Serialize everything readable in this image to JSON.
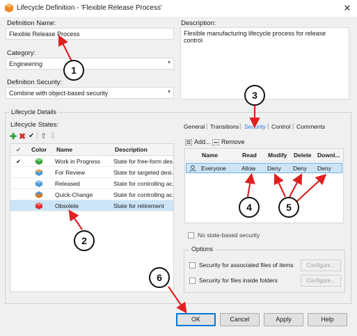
{
  "window": {
    "title": "Lifecycle Definition - 'Flexible Release Process'",
    "close_glyph": "✕"
  },
  "definition": {
    "name_label": "Definition Name:",
    "name_value": "Flexible Release Process",
    "category_label": "Category:",
    "category_value": "Engineering",
    "security_label": "Definition Security:",
    "security_value": "Combine with object-based security",
    "description_label": "Description:",
    "description_value": "Flexible manufacturing lifecycle process for release control"
  },
  "lifecycle": {
    "group_title": "Lifecycle Details",
    "states_label": "Lifecycle States:",
    "toolbar": [
      "add-icon",
      "delete-icon",
      "check-icon",
      "move-up-icon",
      "move-down-icon"
    ],
    "columns": [
      "Color",
      "Name",
      "Description"
    ],
    "states": [
      {
        "default": "✔",
        "name": "Work in Progress",
        "description": "State for free-form des...",
        "color": "#3aa63a"
      },
      {
        "default": "",
        "name": "For Review",
        "description": "State for targeted desi...",
        "color": "#4d9ad8"
      },
      {
        "default": "",
        "name": "Released",
        "description": "State for controlling ac...",
        "color": "#4d9ad8"
      },
      {
        "default": "",
        "name": "Quick-Change",
        "description": "State for controlling ac...",
        "color": "#d07a2a"
      },
      {
        "default": "",
        "name": "Obsolete",
        "description": "State for retirement",
        "color": "#d63030"
      }
    ]
  },
  "tabs": {
    "items": [
      "General",
      "Transitions",
      "Security",
      "Control",
      "Comments"
    ],
    "active": "Security"
  },
  "security": {
    "add_label": "Add...",
    "remove_label": "Remove",
    "columns": [
      "Name",
      "Read",
      "Modify",
      "Delete",
      "Downl..."
    ],
    "rows": [
      {
        "name": "Everyone",
        "read": "Allow",
        "modify": "Deny",
        "delete": "Deny",
        "download": "Deny"
      }
    ],
    "no_state_security_label": "No state-based security"
  },
  "options": {
    "group_title": "Options",
    "items": [
      {
        "label": "Security for associated files of items",
        "button": "Configure..."
      },
      {
        "label": "Security for files inside folders",
        "button": "Configure..."
      }
    ]
  },
  "buttons": {
    "ok": "OK",
    "cancel": "Cancel",
    "apply": "Apply",
    "help": "Help"
  },
  "annotations": [
    "1",
    "2",
    "3",
    "4",
    "5",
    "6"
  ],
  "colors": {
    "annotation_arrow": "#e02020",
    "selection": "#cce4f7",
    "accent": "#0078d7",
    "active_tab": "#2a7ad4"
  }
}
